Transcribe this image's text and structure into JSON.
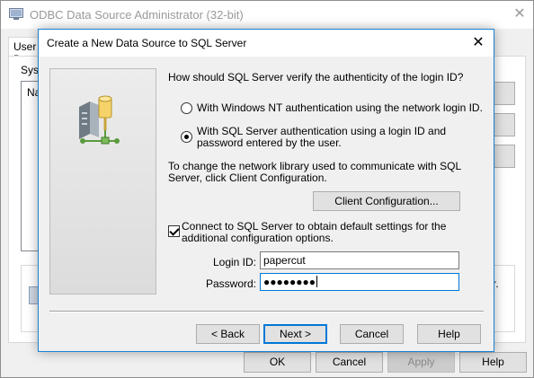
{
  "parent": {
    "title": "ODBC Data Source Administrator (32-bit)",
    "close_glyph": "✕",
    "tab_label": "User D",
    "system_label_fragment": "Syst",
    "list_item_fragment": "Na",
    "right_text_fragment": "r.",
    "buttons": {
      "ok": "OK",
      "cancel": "Cancel",
      "apply": "Apply",
      "help": "Help"
    }
  },
  "dialog": {
    "title": "Create a New Data Source to SQL Server",
    "close_glyph": "✕",
    "auth_prompt": "How should SQL Server verify the authenticity of the login ID?",
    "auth_options": [
      {
        "label": "With Windows NT authentication using the network login ID.",
        "selected": false
      },
      {
        "label": "With SQL Server authentication using a login ID and password entered by the user.",
        "selected": true
      }
    ],
    "network_library_text": "To change the network library used to communicate with SQL Server, click Client Configuration.",
    "client_config_button": "Client Configuration...",
    "connect_checkbox": {
      "label": "Connect to SQL Server to obtain default settings for the additional configuration options.",
      "checked": true
    },
    "login_id": {
      "label": "Login ID:",
      "value": "papercut"
    },
    "password": {
      "label": "Password:",
      "masked_value": "●●●●●●●●"
    },
    "buttons": {
      "back": "< Back",
      "next": "Next >",
      "cancel": "Cancel",
      "help": "Help"
    },
    "banner_icon": "server-with-key-icon"
  },
  "colors": {
    "accent": "#0078d7",
    "dialog_border": "#1883d7",
    "face": "#f0f0f0",
    "button_face": "#e1e1e1"
  }
}
